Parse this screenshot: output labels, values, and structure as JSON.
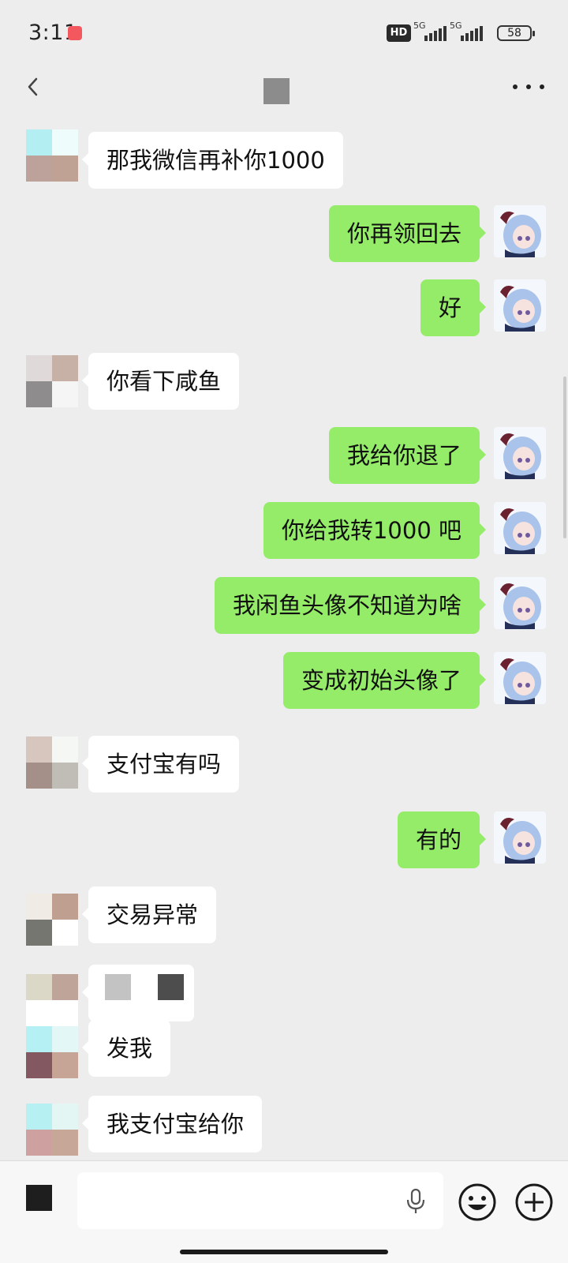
{
  "status_bar": {
    "time": "3:11",
    "hd_label": "HD",
    "signal_1_label": "5G",
    "signal_2_label": "5G",
    "battery": "58"
  },
  "nav": {
    "back_icon": "chevron-left-icon",
    "more_icon": "more-dots-icon"
  },
  "colors": {
    "background": "#ededed",
    "outgoing_bubble": "#95ec69",
    "incoming_bubble": "#ffffff"
  },
  "messages": [
    {
      "side": "in",
      "text": "那我微信再补你1000"
    },
    {
      "side": "out",
      "text": "你再领回去"
    },
    {
      "side": "out",
      "text": "好"
    },
    {
      "side": "in",
      "text": "你看下咸鱼"
    },
    {
      "side": "out",
      "text": "我给你退了"
    },
    {
      "side": "out",
      "text": "你给我转1000 吧"
    },
    {
      "side": "out",
      "text": "我闲鱼头像不知道为啥"
    },
    {
      "side": "out",
      "text": "变成初始头像了"
    },
    {
      "side": "in",
      "text": "支付宝有吗"
    },
    {
      "side": "out",
      "text": "有的"
    },
    {
      "side": "in",
      "text": "交易异常"
    },
    {
      "side": "in",
      "text": ""
    },
    {
      "side": "in",
      "text": "发我"
    },
    {
      "side": "in",
      "text": "我支付宝给你"
    }
  ],
  "input_bar": {
    "placeholder": "",
    "mic_icon": "microphone-icon",
    "emoji_icon": "emoji-icon",
    "plus_icon": "plus-circle-icon"
  }
}
